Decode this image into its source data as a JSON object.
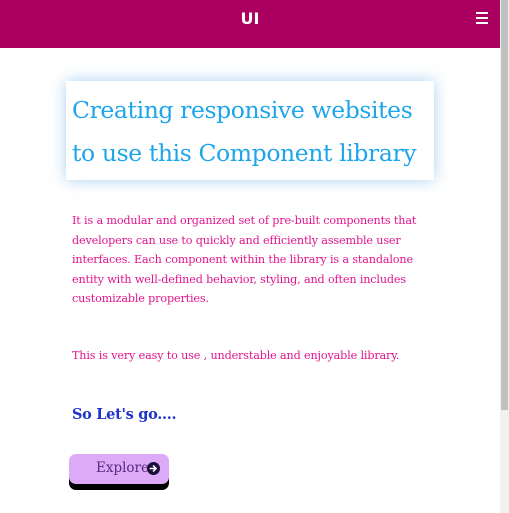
{
  "header": {
    "title": "UI",
    "menu_icon": "hamburger-menu-icon",
    "background_color": "#ac0060"
  },
  "hero": {
    "title": "Creating responsive websites to use this Component library",
    "title_color": "#1ea5ea"
  },
  "content": {
    "description": "It is a modular and organized set of pre-built components that developers can use to quickly and efficiently assemble user interfaces. Each component within the library is a standalone entity with well-defined behavior, styling, and often includes customizable properties.",
    "tagline": "This is very easy to use , understable and enjoyable library.",
    "text_color": "#e0158e"
  },
  "cta": {
    "heading": "So Let's go....",
    "button_label": "Explore",
    "button_icon": "arrow-circle-right-icon",
    "button_color": "#dcaaf6"
  }
}
